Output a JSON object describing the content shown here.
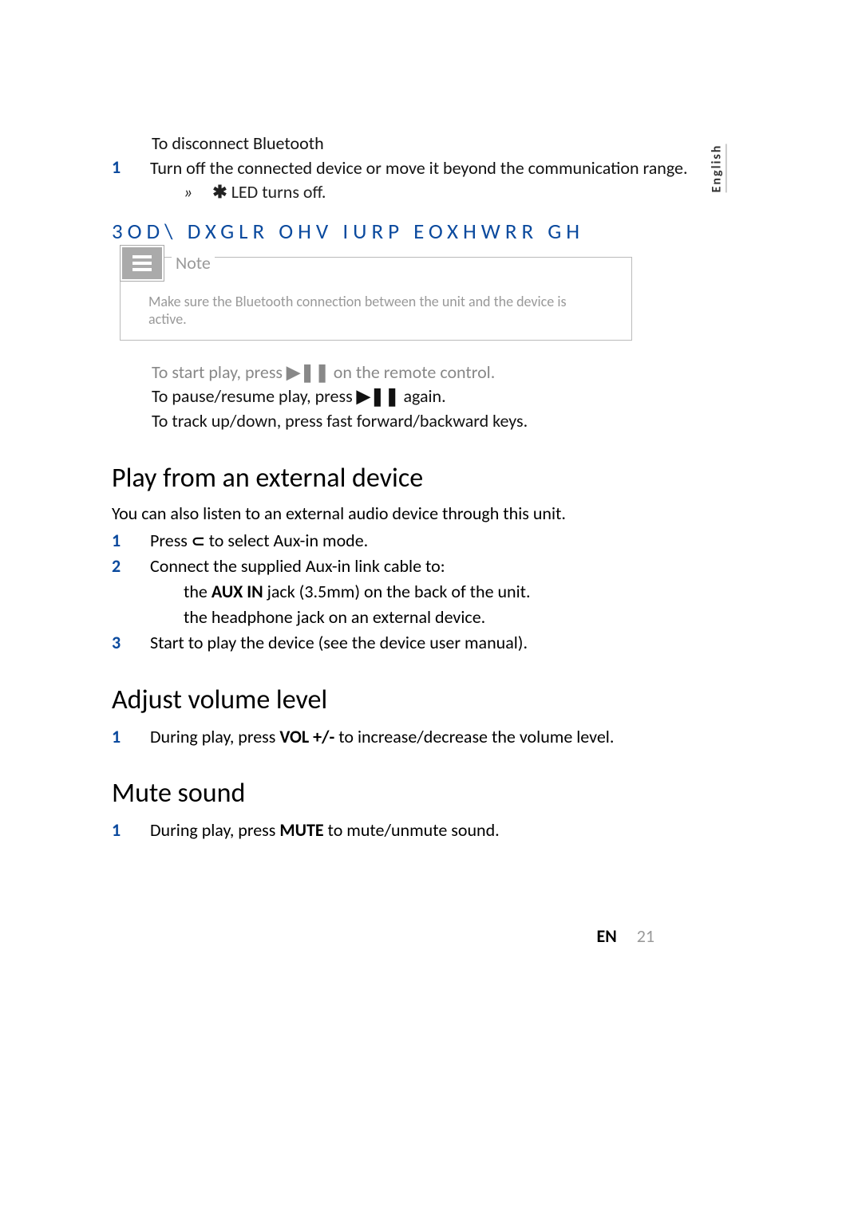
{
  "lang": "English",
  "disconnect": {
    "title": "To disconnect Bluetooth",
    "step1_num": "1",
    "step1_text": "Turn off the connected device or move it beyond the communication range.",
    "sub_arrow": "»",
    "sub_text": "LED turns off.",
    "bt_glyph": "✱"
  },
  "garbled_heading": "3OD\\ DXGLR  OHV IURP EOXHWRR     GH",
  "note": {
    "label": "Note",
    "body": "Make sure the Bluetooth connection between the unit and the device is active."
  },
  "play_controls": {
    "line1_pre": "To start play, press ",
    "line1_post": " on the remote control.",
    "line2_pre": "To pause/resume play, press ",
    "line2_post": " again.",
    "line3": "To track up/down, press fast forward/backward keys.",
    "play_glyph": "▶❚❚"
  },
  "external": {
    "heading": "Play from an external device",
    "intro": "You can also listen to an external audio device through this unit.",
    "step1_num": "1",
    "step1_pre": "Press ",
    "step1_post": " to select Aux-in mode.",
    "source_glyph": "⊂",
    "step2_num": "2",
    "step2_text": "Connect the supplied Aux-in link cable to:",
    "step2_sub1_pre": "the ",
    "step2_sub1_bold": "AUX IN",
    "step2_sub1_post": "  jack (3.5mm) on the back of the unit.",
    "step2_sub2": "the headphone jack on an external device.",
    "step3_num": "3",
    "step3_text": "Start to play the device (see the device user manual)."
  },
  "volume": {
    "heading": "Adjust volume level",
    "step1_num": "1",
    "step1_pre": "During play, press ",
    "step1_bold": "VOL +/-",
    "step1_post": " to increase/decrease the volume level."
  },
  "mute": {
    "heading": "Mute sound",
    "step1_num": "1",
    "step1_pre": "During play, press ",
    "step1_bold": "MUTE",
    "step1_post": " to mute/unmute sound."
  },
  "footer": {
    "lang_code": "EN",
    "page_num": "21"
  }
}
